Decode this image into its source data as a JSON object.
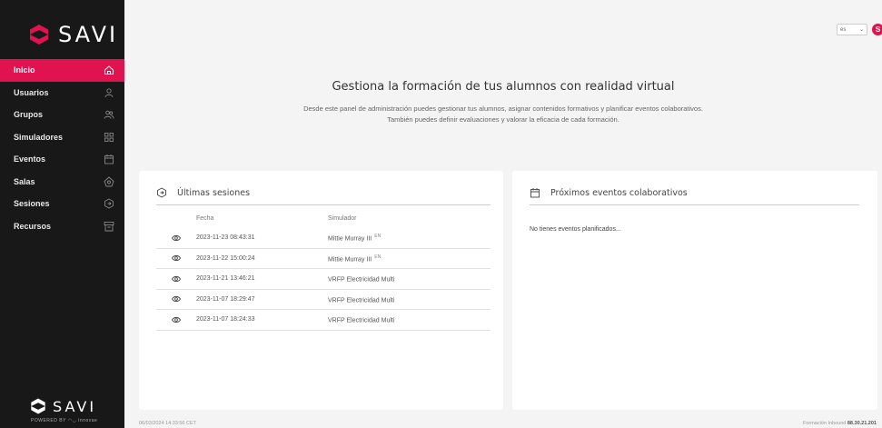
{
  "brand": {
    "name": "SAVI",
    "powered_by": "POWERED BY  ◠◡ innovae",
    "accent": "#e0124f"
  },
  "sidebar": {
    "items": [
      {
        "label": "Inicio",
        "icon": "home-icon",
        "active": true
      },
      {
        "label": "Usuarios",
        "icon": "user-icon",
        "active": false
      },
      {
        "label": "Grupos",
        "icon": "group-icon",
        "active": false
      },
      {
        "label": "Simuladores",
        "icon": "grid-icon",
        "active": false
      },
      {
        "label": "Eventos",
        "icon": "calendar-icon",
        "active": false
      },
      {
        "label": "Salas",
        "icon": "building-icon",
        "active": false
      },
      {
        "label": "Sesiones",
        "icon": "session-icon",
        "active": false
      },
      {
        "label": "Recursos",
        "icon": "archive-icon",
        "active": false
      }
    ]
  },
  "header": {
    "language": "es",
    "user_initial": "S"
  },
  "hero": {
    "title": "Gestiona la formación de tus alumnos con realidad virtual",
    "line1": "Desde este panel de administración puedes gestionar tus alumnos, asignar contenidos formativos y planificar eventos colaborativos.",
    "line2": "También puedes definir evaluaciones y valorar la eficacia de cada formación."
  },
  "sessions_card": {
    "title": "Últimas sesiones",
    "columns": [
      "Fecha",
      "Simulador"
    ],
    "rows": [
      {
        "date": "2023-11-23 08:43:31",
        "simulator": "Mittie Murray III",
        "lang": "EN"
      },
      {
        "date": "2023-11-22 15:00:24",
        "simulator": "Mittie Murray III",
        "lang": "EN"
      },
      {
        "date": "2023-11-21 13:46:21",
        "simulator": "VRFP Electricidad Multi",
        "lang": ""
      },
      {
        "date": "2023-11-07 18:29:47",
        "simulator": "VRFP Electricidad Multi",
        "lang": ""
      },
      {
        "date": "2023-11-07 18:24:33",
        "simulator": "VRFP Electricidad Multi",
        "lang": ""
      }
    ]
  },
  "events_card": {
    "title": "Próximos eventos colaborativos",
    "empty": "No tienes eventos planificados..."
  },
  "footer": {
    "timestamp": "06/03/2024 14:33:56 CET",
    "right_text": "Formación Inbound ",
    "right_value": "88.30.21.201"
  }
}
